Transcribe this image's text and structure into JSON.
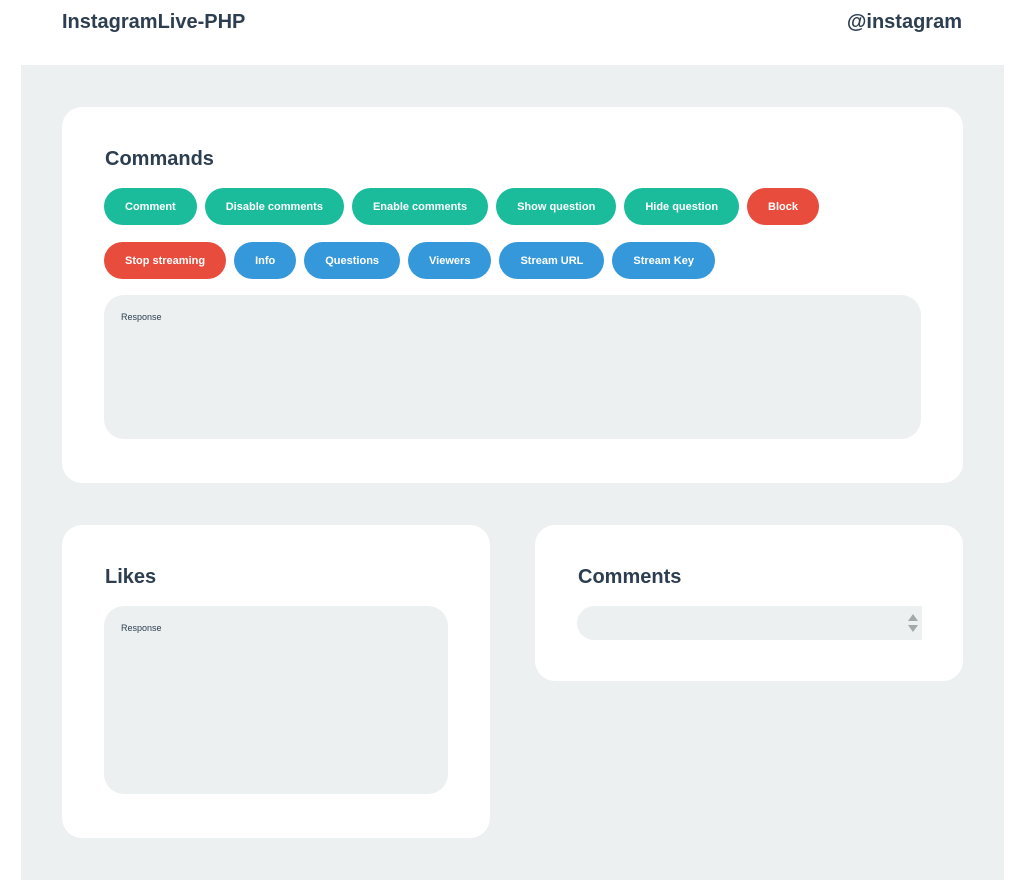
{
  "header": {
    "brand": "InstagramLive-PHP",
    "handle": "@instagram"
  },
  "commands": {
    "title": "Commands",
    "row1": [
      {
        "label": "Comment",
        "color": "#1abc9c"
      },
      {
        "label": "Disable comments",
        "color": "#1abc9c"
      },
      {
        "label": "Enable comments",
        "color": "#1abc9c"
      },
      {
        "label": "Show question",
        "color": "#1abc9c"
      },
      {
        "label": "Hide question",
        "color": "#1abc9c"
      },
      {
        "label": "Block",
        "color": "#e74c3c"
      }
    ],
    "row2": [
      {
        "label": "Stop streaming",
        "color": "#e74c3c"
      },
      {
        "label": "Info",
        "color": "#3498db"
      },
      {
        "label": "Questions",
        "color": "#3498db"
      },
      {
        "label": "Viewers",
        "color": "#3498db"
      },
      {
        "label": "Stream URL",
        "color": "#3498db"
      },
      {
        "label": "Stream Key",
        "color": "#3498db"
      }
    ],
    "response": "Response"
  },
  "likes": {
    "title": "Likes",
    "response": "Response"
  },
  "comments": {
    "title": "Comments",
    "value": "",
    "spinner_up_icon": "chevron-up-icon",
    "spinner_down_icon": "chevron-down-icon"
  },
  "colors": {
    "green": "#1abc9c",
    "red": "#e74c3c",
    "blue": "#3498db",
    "background": "#ecf0f1",
    "text": "#2c3e50"
  }
}
